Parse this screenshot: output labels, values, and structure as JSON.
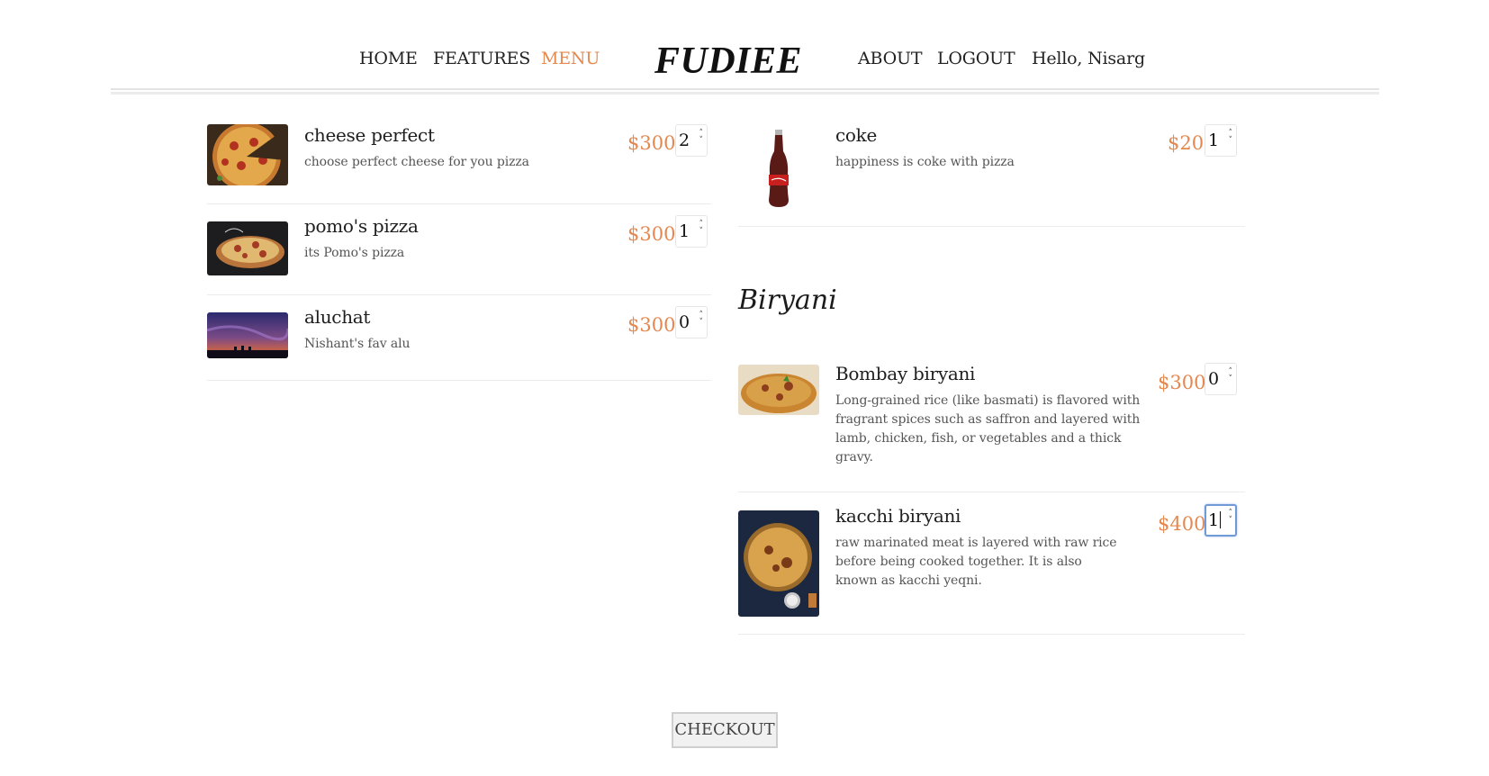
{
  "nav": {
    "home": "HOME",
    "features": "FEATURES",
    "menu": "MENU",
    "logo": "FUDIEE",
    "about": "ABOUT",
    "logout": "LOGOUT",
    "greeting": "Hello, Nisarg"
  },
  "menu": {
    "left_items": [
      {
        "name": "cheese perfect",
        "description": "choose perfect cheese for you pizza",
        "price": "$300",
        "quantity": "2"
      },
      {
        "name": "pomo's pizza",
        "description": "its Pomo's pizza",
        "price": "$300",
        "quantity": "1"
      },
      {
        "name": "aluchat",
        "description": "Nishant's fav alu",
        "price": "$300",
        "quantity": "0"
      }
    ],
    "right_items": [
      {
        "name": "coke",
        "description": "happiness is coke with pizza",
        "price": "$20",
        "quantity": "1"
      }
    ],
    "biryani_title": "Biryani",
    "biryani_items": [
      {
        "name": "Bombay biryani",
        "description": "Long-grained rice (like basmati) is flavored with fragrant spices such as saffron and layered with lamb, chicken, fish, or vegetables and a thick gravy.",
        "price": "$300",
        "quantity": "0"
      },
      {
        "name": "kacchi biryani",
        "description": "raw marinated meat is layered with raw rice before being cooked together. It is also known as kacchi yeqni.",
        "price": "$400",
        "quantity": "1"
      }
    ]
  },
  "checkout_label": "CHECKOUT",
  "colors": {
    "accent": "#e5884f",
    "focus": "#6f9ad6"
  },
  "icons": {
    "spinner": "spin-up-down-icon"
  }
}
